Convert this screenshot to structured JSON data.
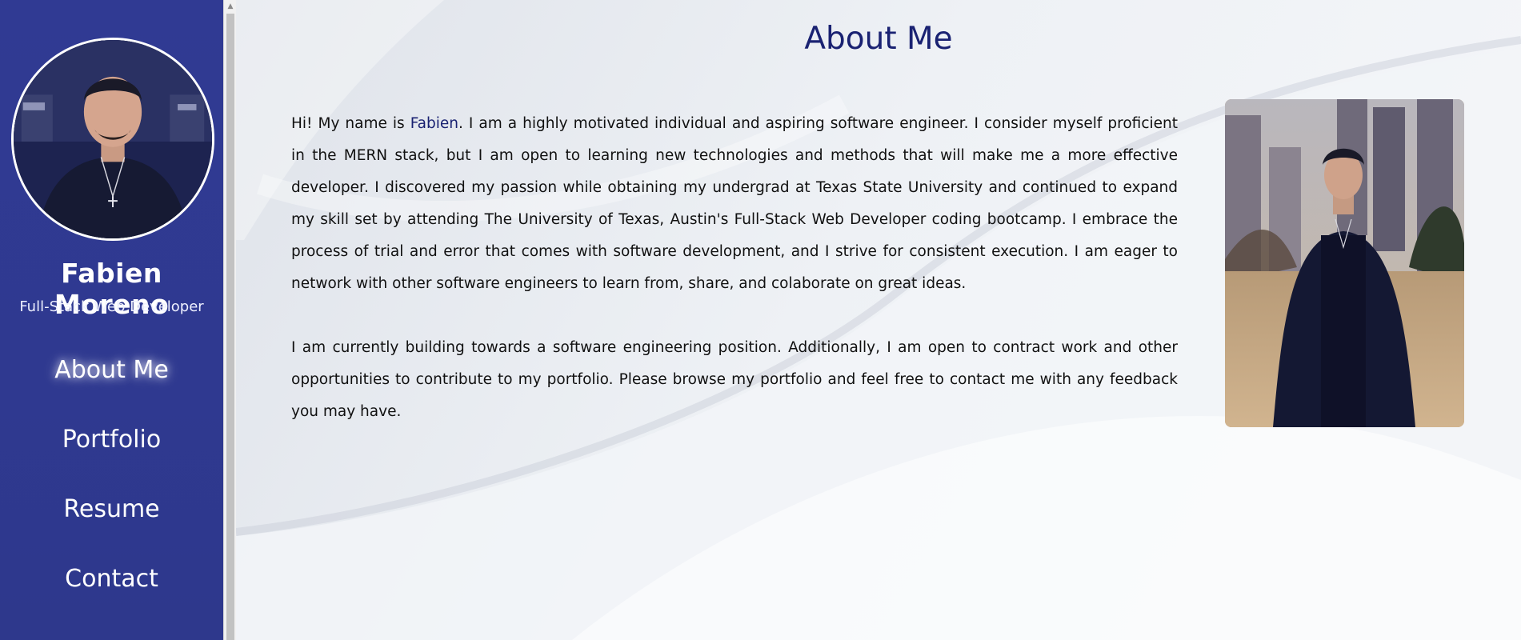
{
  "sidebar": {
    "name": "Fabien Moreno",
    "role": "Full-Stack Web Developer",
    "nav": [
      {
        "label": "About Me",
        "active": true
      },
      {
        "label": "Portfolio",
        "active": false
      },
      {
        "label": "Resume",
        "active": false
      },
      {
        "label": "Contact",
        "active": false
      }
    ]
  },
  "main": {
    "title": "About Me",
    "bio": {
      "p1_before": "Hi! My name is ",
      "p1_name": "Fabien",
      "p1_after": ". I am a highly motivated individual and aspiring software engineer. I consider myself proficient in the MERN stack, but I am open to learning new technologies and methods that will make me a more effective developer. I discovered my passion while obtaining my undergrad at Texas State University and continued to expand my skill set by attending The University of Texas, Austin's Full-Stack Web Developer coding bootcamp. I embrace the process of trial and error that comes with software development, and I strive for consistent execution. I am eager to network with other software engineers to learn from, share, and colaborate on great ideas.",
      "p2": "I am currently building towards a software engineering position. Additionally, I am open to contract work and other opportunities to contribute to my portfolio. Please browse my portfolio and feel free to contact me with any feedback you may have."
    }
  },
  "colors": {
    "sidebar_bg": "#303a93",
    "title": "#1a2272",
    "highlight": "#1a2272"
  },
  "icons": {
    "scroll_up": "▲"
  }
}
